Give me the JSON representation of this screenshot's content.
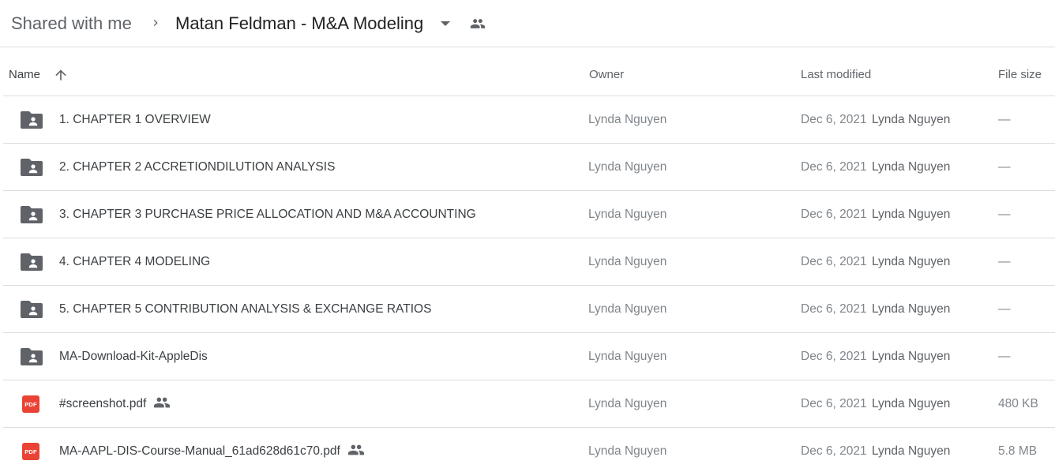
{
  "breadcrumb": {
    "root": "Shared with me",
    "current": "Matan Feldman - M&A Modeling"
  },
  "columns": {
    "name": "Name",
    "owner": "Owner",
    "modified": "Last modified",
    "size": "File size"
  },
  "colors": {
    "folder_icon": "#5f6368",
    "pdf_badge": "#ea4335",
    "divider": "#dadce0"
  },
  "files": [
    {
      "name": "1. CHAPTER 1 OVERVIEW",
      "type": "shared-folder",
      "owner": "Lynda Nguyen",
      "date": "Dec 6, 2021",
      "modifier": "Lynda Nguyen",
      "size": "—",
      "shared": false
    },
    {
      "name": "2. CHAPTER 2 ACCRETIONDILUTION ANALYSIS",
      "type": "shared-folder",
      "owner": "Lynda Nguyen",
      "date": "Dec 6, 2021",
      "modifier": "Lynda Nguyen",
      "size": "—",
      "shared": false
    },
    {
      "name": "3. CHAPTER 3 PURCHASE PRICE ALLOCATION AND M&A ACCOUNTING",
      "type": "shared-folder",
      "owner": "Lynda Nguyen",
      "date": "Dec 6, 2021",
      "modifier": "Lynda Nguyen",
      "size": "—",
      "shared": false
    },
    {
      "name": "4. CHAPTER 4 MODELING",
      "type": "shared-folder",
      "owner": "Lynda Nguyen",
      "date": "Dec 6, 2021",
      "modifier": "Lynda Nguyen",
      "size": "—",
      "shared": false
    },
    {
      "name": "5. CHAPTER 5 CONTRIBUTION ANALYSIS & EXCHANGE RATIOS",
      "type": "shared-folder",
      "owner": "Lynda Nguyen",
      "date": "Dec 6, 2021",
      "modifier": "Lynda Nguyen",
      "size": "—",
      "shared": false
    },
    {
      "name": "MA-Download-Kit-AppleDis",
      "type": "shared-folder",
      "owner": "Lynda Nguyen",
      "date": "Dec 6, 2021",
      "modifier": "Lynda Nguyen",
      "size": "—",
      "shared": false
    },
    {
      "name": "#screenshot.pdf",
      "type": "pdf",
      "badge": "PDF",
      "owner": "Lynda Nguyen",
      "date": "Dec 6, 2021",
      "modifier": "Lynda Nguyen",
      "size": "480 KB",
      "shared": true
    },
    {
      "name": "MA-AAPL-DIS-Course-Manual_61ad628d61c70.pdf",
      "type": "pdf",
      "badge": "PDF",
      "owner": "Lynda Nguyen",
      "date": "Dec 6, 2021",
      "modifier": "Lynda Nguyen",
      "size": "5.8 MB",
      "shared": true
    }
  ]
}
